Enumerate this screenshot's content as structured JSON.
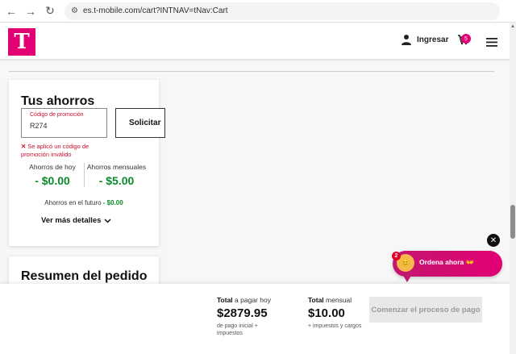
{
  "browser": {
    "url": "es.t-mobile.com/cart?INTNAV=tNav:Cart",
    "back_glyph": "←",
    "forward_glyph": "→",
    "reload_glyph": "↻"
  },
  "header": {
    "logo_text": "T",
    "login_label": "Ingresar",
    "cart_count": "5"
  },
  "savings": {
    "title": "Tus ahorros",
    "promo_label": "Código de promoción",
    "promo_value": "R274",
    "apply_label": "Solicitar",
    "error_text": "Se aplicó un código de promoción inválido",
    "today_label": "Ahorros de hoy",
    "today_value": "- $0.00",
    "monthly_label": "Ahorros mensuales",
    "monthly_value": "- $5.00",
    "future_label": "Ahorros en el futuro",
    "future_value": "- $0.00",
    "details_label": "Ver más detalles"
  },
  "summary": {
    "title": "Resumen del pedido"
  },
  "bottom": {
    "today_label_bold": "Total",
    "today_label_rest": " a pagar hoy",
    "today_amount": "$2879.95",
    "today_note": "de pago inicial + impuestos",
    "monthly_label_bold": "Total",
    "monthly_label_rest": " mensual",
    "monthly_amount": "$10.00",
    "monthly_note": "+ impuestos y cargos",
    "checkout_label": "Comenzar el proceso de pago"
  },
  "chat": {
    "count": "2",
    "text": "Ordena ahora 👐",
    "close_glyph": "✕"
  },
  "colors": {
    "brand": "#e20074",
    "savings_green": "#0a8a2a",
    "error_red": "#c8102e"
  }
}
